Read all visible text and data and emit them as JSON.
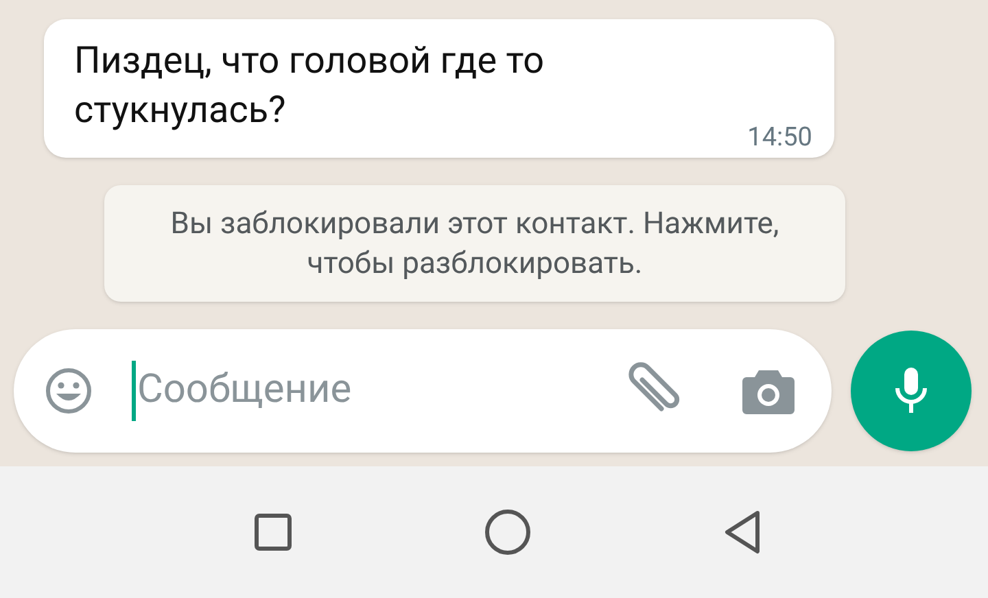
{
  "messages": [
    {
      "text": "Пиздец, что головой где то стукнулась?",
      "time": "14:50"
    }
  ],
  "system_notice": "Вы заблокировали этот контакт. Нажмите, чтобы разблокировать.",
  "composer": {
    "placeholder": "Сообщение"
  }
}
